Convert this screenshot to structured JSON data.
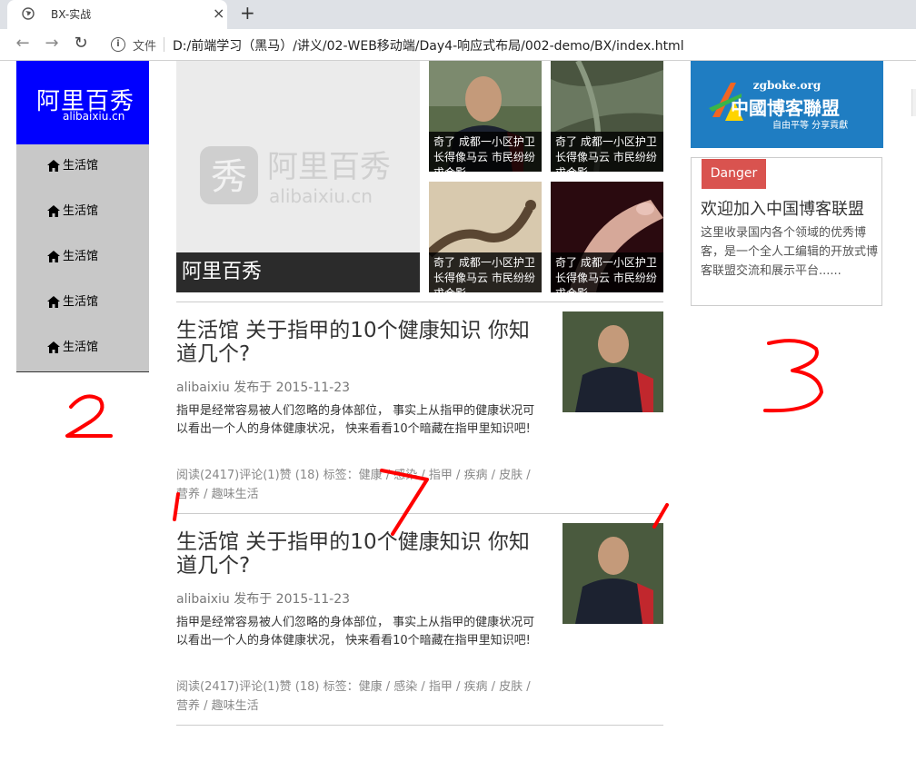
{
  "browser": {
    "tab_title": "BX-实战",
    "tab_close": "×",
    "new_tab": "+",
    "file_label": "文件",
    "url": "D:/前端学习（黑马）/讲义/02-WEB移动端/Day4-响应式布局/002-demo/BX/index.html"
  },
  "logo": {
    "cn": "阿里百秀",
    "en": "alibaixiu.cn"
  },
  "nav": {
    "items": [
      "生活馆",
      "生活馆",
      "生活馆",
      "生活馆",
      "生活馆"
    ]
  },
  "hero": {
    "caption": "阿里百秀",
    "watermark_cn": "阿里百秀",
    "watermark_en": "alibaixiu.cn"
  },
  "thumbs": [
    {
      "caption": "奇了 成都一小区护卫长得像马云 市民纷纷求合影"
    },
    {
      "caption": "奇了 成都一小区护卫长得像马云 市民纷纷求合影"
    },
    {
      "caption": "奇了 成都一小区护卫长得像马云 市民纷纷求合影"
    },
    {
      "caption": "奇了 成都一小区护卫长得像马云 市民纷纷求合影"
    }
  ],
  "articles": [
    {
      "title": "生活馆 关于指甲的10个健康知识 你知道几个?",
      "meta": "alibaixiu 发布于 2015-11-23",
      "body": "指甲是经常容易被人们忽略的身体部位， 事实上从指甲的健康状况可以看出一个人的身体健康状况， 快来看看10个暗藏在指甲里知识吧!",
      "tags": "阅读(2417)评论(1)赞 (18) 标签：健康 / 感染 / 指甲 / 疾病 / 皮肤 / 营养 / 趣味生活"
    },
    {
      "title": "生活馆 关于指甲的10个健康知识 你知道几个?",
      "meta": "alibaixiu 发布于 2015-11-23",
      "body": "指甲是经常容易被人们忽略的身体部位， 事实上从指甲的健康状况可以看出一个人的身体健康状况， 快来看看10个暗藏在指甲里知识吧!",
      "tags": "阅读(2417)评论(1)赞 (18) 标签：健康 / 感染 / 指甲 / 疾病 / 皮肤 / 营养 / 趣味生活"
    }
  ],
  "sidebar": {
    "banner_site": "zgboke.org",
    "banner_name": "中國博客聯盟",
    "banner_slogan": "自由平等  分享貢獻",
    "danger_label": "Danger",
    "card_title": "欢迎加入中国博客联盟",
    "card_text": "这里收录国内各个领域的优秀博客，是一个全人工编辑的开放式博客联盟交流和展示平台......"
  },
  "annotations": [
    "2",
    "3",
    "7",
    "1",
    "1"
  ],
  "colors": {
    "logo_bg": "#0000ff",
    "nav_bg": "#c8c8c8",
    "danger": "#d9534f",
    "banner": "#1f7dc2",
    "annotation": "#ff0000"
  }
}
